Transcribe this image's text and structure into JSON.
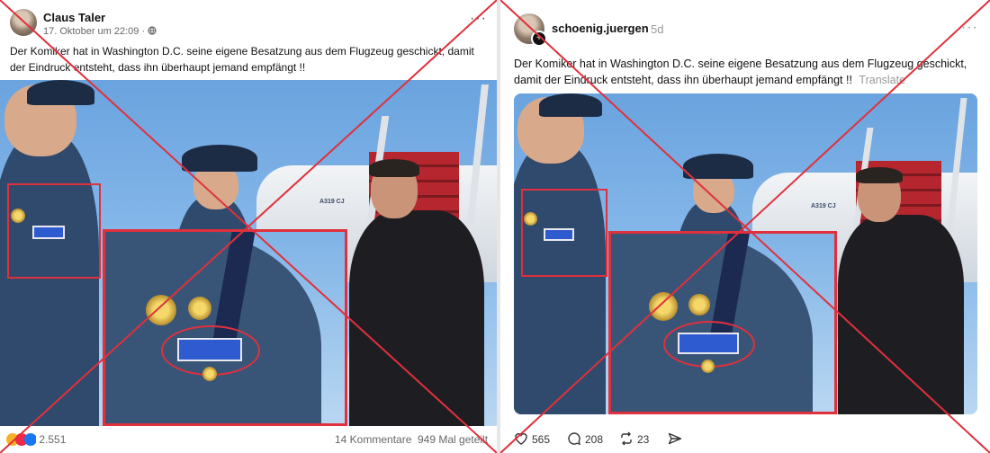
{
  "facebook_post": {
    "author": "Claus Taler",
    "timestamp": "17. Oktober um 22:09",
    "separator": "·",
    "text": "Der Komiker hat in Washington D.C. seine eigene Besatzung aus dem Flugzeug geschickt, damit der Eindruck entsteht, dass ihn überhaupt jemand empfängt !!",
    "reaction_count": "2.551",
    "comments": "14 Kommentare",
    "shares": "949 Mal geteilt",
    "aircraft_label": "A319 CJ"
  },
  "threads_post": {
    "author": "schoenig.juergen",
    "age": "5d",
    "text": "Der Komiker hat in Washington D.C. seine eigene Besatzung aus dem Flugzeug geschickt, damit der Eindruck entsteht, dass ihn überhaupt jemand empfängt !!",
    "translate": "Translate",
    "likes": "565",
    "replies": "208",
    "reposts": "23",
    "aircraft_label": "A319 CJ"
  },
  "colors": {
    "crossout_red": "#e0303c",
    "stairs_red": "#b5262f",
    "uniform_blue": "#2f4a6d",
    "sky_blue": "#8bbcec"
  },
  "icons": [
    "globe-icon",
    "more-icon",
    "reaction-icons",
    "heart-icon",
    "comment-icon",
    "repost-icon",
    "share-icon",
    "add-follow-icon"
  ]
}
